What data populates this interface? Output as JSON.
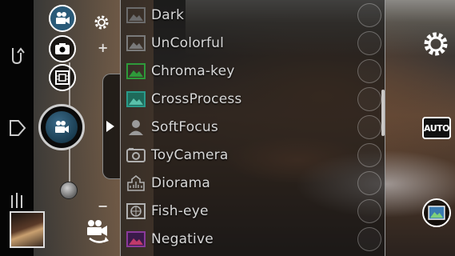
{
  "effects_menu": {
    "items": [
      {
        "label": "Dark",
        "icon": "landscape-icon",
        "color": "#6b6b6b"
      },
      {
        "label": "UnColorful",
        "icon": "landscape-icon",
        "color": "#7a7a7a"
      },
      {
        "label": "Chroma-key",
        "icon": "landscape-icon",
        "color": "#2e9a3a"
      },
      {
        "label": "CrossProcess",
        "icon": "landscape-icon",
        "color": "#2a9a8a"
      },
      {
        "label": "SoftFocus",
        "icon": "person-icon",
        "color": "#9a9a9a"
      },
      {
        "label": "ToyCamera",
        "icon": "toy-camera-icon",
        "color": "#b0b0b0"
      },
      {
        "label": "Diorama",
        "icon": "buildings-icon",
        "color": "#b0b0b0"
      },
      {
        "label": "Fish-eye",
        "icon": "fisheye-icon",
        "color": "#b0b0b0"
      },
      {
        "label": "Negative",
        "icon": "landscape-icon",
        "color": "#8a3a9a"
      }
    ]
  },
  "zoom": {
    "plus": "+",
    "minus": "−",
    "level": 0.0
  },
  "settings": {
    "auto_label": "AUTO"
  },
  "accent": "#ffffff"
}
